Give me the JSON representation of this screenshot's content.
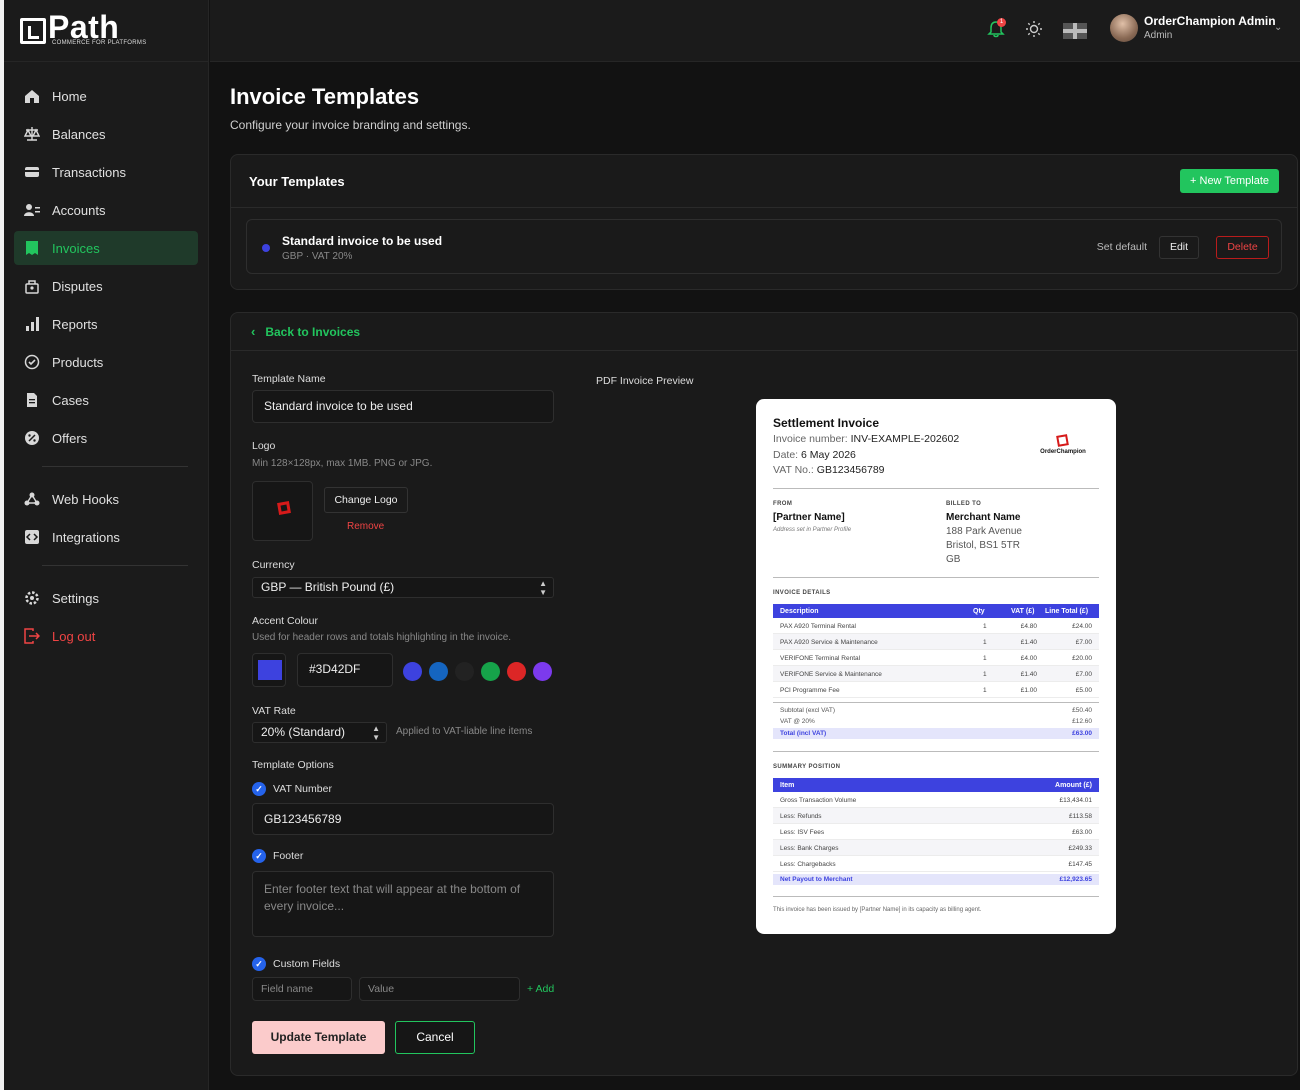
{
  "brand": {
    "name": "Path",
    "tagline": "COMMERCE FOR PLATFORMS"
  },
  "sidebar": {
    "items": [
      {
        "label": "Home",
        "icon": "home-icon"
      },
      {
        "label": "Balances",
        "icon": "scale-icon"
      },
      {
        "label": "Transactions",
        "icon": "card-icon"
      },
      {
        "label": "Accounts",
        "icon": "users-icon"
      },
      {
        "label": "Invoices",
        "icon": "invoice-icon",
        "active": true
      },
      {
        "label": "Disputes",
        "icon": "dispute-icon"
      },
      {
        "label": "Reports",
        "icon": "bar-chart-icon"
      },
      {
        "label": "Products",
        "icon": "products-icon"
      },
      {
        "label": "Cases",
        "icon": "file-icon"
      },
      {
        "label": "Offers",
        "icon": "offer-icon"
      },
      {
        "label": "Web Hooks",
        "icon": "webhook-icon"
      },
      {
        "label": "Integrations",
        "icon": "integrations-icon"
      },
      {
        "label": "Settings",
        "icon": "gear-icon"
      },
      {
        "label": "Log out",
        "icon": "logout-icon"
      }
    ]
  },
  "topbar": {
    "notification_count": "1",
    "user_name": "OrderChampion Admin",
    "user_role": "Admin"
  },
  "page": {
    "title": "Invoice Templates",
    "subtitle": "Configure your invoice branding and settings."
  },
  "templates": {
    "heading": "Your Templates",
    "new_button": "+ New Template",
    "items": [
      {
        "name": "Standard invoice to be used",
        "meta": "GBP · VAT 20%",
        "set_default": "Set default",
        "edit": "Edit",
        "delete": "Delete"
      }
    ]
  },
  "editor": {
    "back_label": "Back to Invoices",
    "template_name_label": "Template Name",
    "template_name_value": "Standard invoice to be used",
    "logo_label": "Logo",
    "logo_hint": "Min 128×128px, max 1MB. PNG or JPG.",
    "change_logo": "Change Logo",
    "remove": "Remove",
    "currency_label": "Currency",
    "currency_value": "GBP — British Pound (£)",
    "accent_label": "Accent Colour",
    "accent_hint": "Used for header rows and totals highlighting in the invoice.",
    "accent_value": "#3D42DF",
    "accent_options": [
      "#3d42df",
      "#1565c0",
      "#222222",
      "#16a34a",
      "#dc2626",
      "#7c3aed"
    ],
    "vat_label": "VAT Rate",
    "vat_value": "20% (Standard)",
    "vat_hint": "Applied to VAT-liable line items",
    "options_label": "Template Options",
    "vat_number_label": "VAT Number",
    "vat_number_value": "GB123456789",
    "footer_label": "Footer",
    "footer_placeholder": "Enter footer text that will appear at the bottom of every invoice...",
    "custom_fields_label": "Custom Fields",
    "field_name_placeholder": "Field name",
    "value_placeholder": "Value",
    "add_label": "+ Add",
    "update_button": "Update Template",
    "cancel_button": "Cancel"
  },
  "preview": {
    "heading": "PDF Invoice Preview",
    "title": "Settlement Invoice",
    "invoice_number_label": "Invoice number:",
    "invoice_number": "INV-EXAMPLE-202602",
    "date_label": "Date:",
    "date": "6 May 2026",
    "vat_label": "VAT No.:",
    "vat_no": "GB123456789",
    "logo_text": "OrderChampion",
    "from_cap": "FROM",
    "from_name": "[Partner Name]",
    "from_note": "Address set in Partner Profile",
    "billed_cap": "BILLED TO",
    "billed_name": "Merchant Name",
    "billed_addr1": "188 Park Avenue",
    "billed_addr2": "Bristol, BS1 5TR",
    "billed_addr3": "GB",
    "details_cap": "INVOICE DETAILS",
    "details_headers": [
      "Description",
      "Qty",
      "VAT (£)",
      "Line Total (£)"
    ],
    "details_rows": [
      [
        "PAX A920 Terminal Rental",
        "1",
        "£4.80",
        "£24.00"
      ],
      [
        "PAX A920 Service & Maintenance",
        "1",
        "£1.40",
        "£7.00"
      ],
      [
        "VERIFONE Terminal Rental",
        "1",
        "£4.00",
        "£20.00"
      ],
      [
        "VERIFONE Service & Maintenance",
        "1",
        "£1.40",
        "£7.00"
      ],
      [
        "PCI Programme Fee",
        "1",
        "£1.00",
        "£5.00"
      ]
    ],
    "subtotal_label": "Subtotal (excl VAT)",
    "subtotal": "£50.40",
    "vat_line_label": "VAT @ 20%",
    "vat_line": "£12.60",
    "total_label": "Total (incl VAT)",
    "total": "£63.00",
    "summary_cap": "SUMMARY POSITION",
    "summary_headers": [
      "Item",
      "Amount (£)"
    ],
    "summary_rows": [
      [
        "Gross Transaction Volume",
        "£13,434.01"
      ],
      [
        "Less: Refunds",
        "£113.58"
      ],
      [
        "Less: ISV Fees",
        "£63.00"
      ],
      [
        "Less: Bank Charges",
        "£249.33"
      ],
      [
        "Less: Chargebacks",
        "£147.45"
      ]
    ],
    "payout_label": "Net Payout to Merchant",
    "payout": "£12,923.65",
    "footer_note": "This invoice has been issued by [Partner Name] in its capacity as billing agent."
  }
}
